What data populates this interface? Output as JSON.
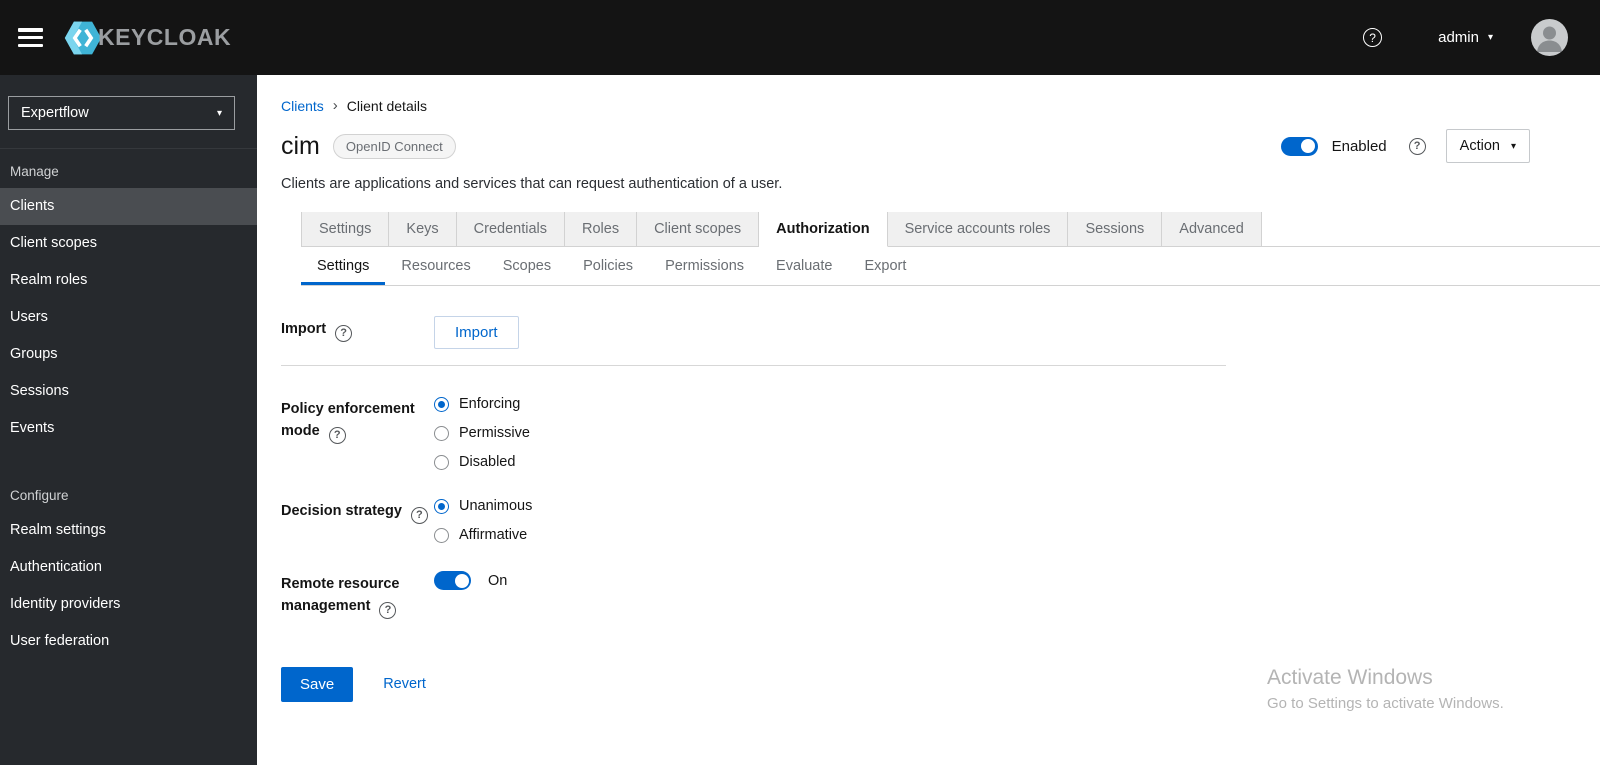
{
  "colors": {
    "accent": "#0066cc",
    "header_bg": "#141414",
    "sidebar_bg": "#26292d"
  },
  "icons": {
    "help": "?",
    "caret_down": "▾",
    "breadcrumb_separator": "›"
  },
  "header": {
    "logo_text": "KEYCLOAK",
    "username": "admin"
  },
  "sidebar": {
    "realm_selector": "Expertflow",
    "sections": [
      {
        "label": "Manage",
        "items": [
          "Clients",
          "Client scopes",
          "Realm roles",
          "Users",
          "Groups",
          "Sessions",
          "Events"
        ]
      },
      {
        "label": "Configure",
        "items": [
          "Realm settings",
          "Authentication",
          "Identity providers",
          "User federation"
        ]
      }
    ],
    "active_item": "Clients"
  },
  "breadcrumb": {
    "items": [
      "Clients",
      "Client details"
    ]
  },
  "page": {
    "title": "cim",
    "badge": "OpenID Connect",
    "description": "Clients are applications and services that can request authentication of a user.",
    "enabled_label": "Enabled",
    "action_label": "Action"
  },
  "tabs": {
    "main": [
      "Settings",
      "Keys",
      "Credentials",
      "Roles",
      "Client scopes",
      "Authorization",
      "Service accounts roles",
      "Sessions",
      "Advanced"
    ],
    "active_main": "Authorization",
    "sub": [
      "Settings",
      "Resources",
      "Scopes",
      "Policies",
      "Permissions",
      "Evaluate",
      "Export"
    ],
    "active_sub": "Settings"
  },
  "form": {
    "import": {
      "label": "Import",
      "button": "Import"
    },
    "policy_enforcement": {
      "label": "Policy enforcement mode",
      "options": [
        "Enforcing",
        "Permissive",
        "Disabled"
      ],
      "selected": "Enforcing"
    },
    "decision_strategy": {
      "label": "Decision strategy",
      "options": [
        "Unanimous",
        "Affirmative"
      ],
      "selected": "Unanimous"
    },
    "remote_resource": {
      "label": "Remote resource management",
      "toggle_state": "On"
    },
    "save_label": "Save",
    "revert_label": "Revert"
  },
  "watermark": {
    "line1": "Activate Windows",
    "line2": "Go to Settings to activate Windows."
  }
}
